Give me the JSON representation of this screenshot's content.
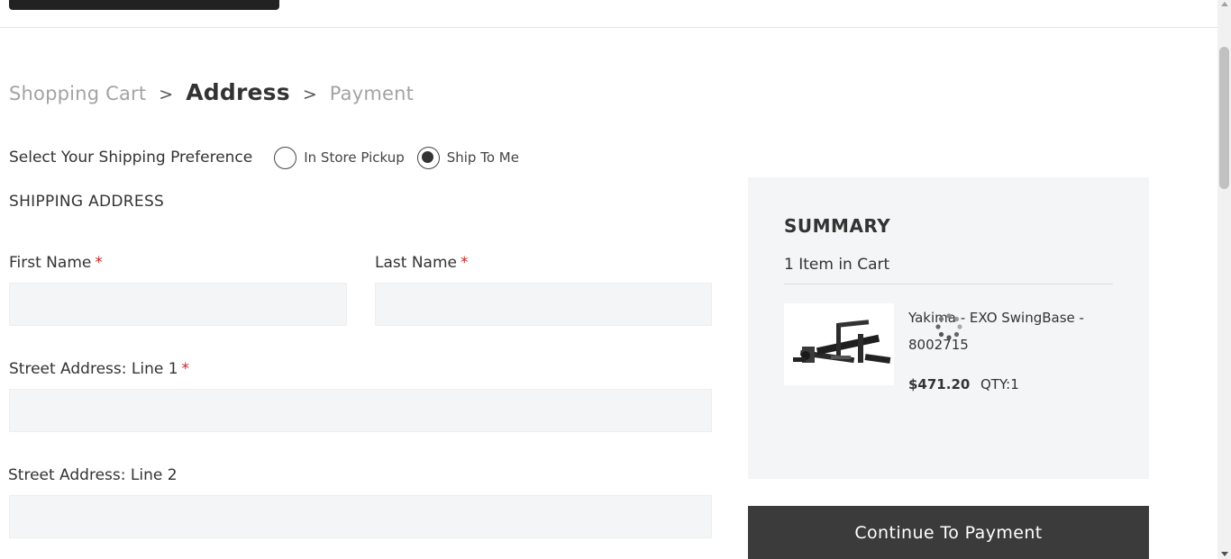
{
  "breadcrumb": {
    "steps": [
      {
        "label": "Shopping Cart"
      },
      {
        "label": "Address"
      },
      {
        "label": "Payment"
      }
    ],
    "separator": ">",
    "active_step": "Address"
  },
  "shipping_preference": {
    "label": "Select Your Shipping Preference",
    "options": [
      {
        "label": "In Store Pickup",
        "selected": false
      },
      {
        "label": "Ship To Me",
        "selected": true
      }
    ]
  },
  "shipping_address": {
    "title": "SHIPPING ADDRESS",
    "required_marker": "*",
    "first_name": {
      "label": "First Name",
      "value": "",
      "required": true
    },
    "last_name": {
      "label": "Last Name",
      "value": "",
      "required": true
    },
    "street1": {
      "label": "Street Address: Line 1",
      "value": "",
      "required": true
    },
    "street2": {
      "label": "Street Address: Line 2",
      "value": "",
      "required": false
    }
  },
  "summary": {
    "title": "SUMMARY",
    "count_text": "1 Item in Cart",
    "item": {
      "name": "Yakima - EXO SwingBase - 8002715",
      "price": "$471.20",
      "qty": "QTY:1",
      "image_icon": "bike-rack-product-image"
    }
  },
  "continue_button": {
    "label": "Continue To Payment"
  },
  "colors": {
    "required": "#c62828",
    "button_bg": "#3b3b3b",
    "summary_bg": "#f4f5f6",
    "input_bg": "#f4f5f6",
    "crumb_inactive": "#a3a3a3"
  }
}
